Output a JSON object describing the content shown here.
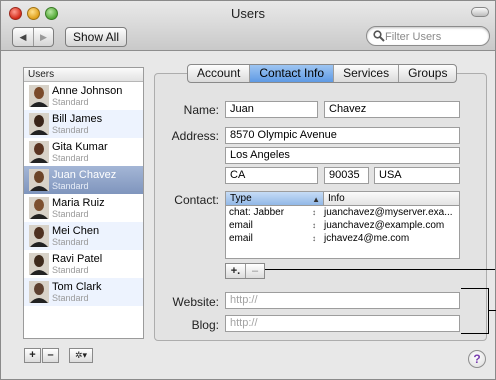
{
  "window": {
    "title": "Users"
  },
  "toolbar": {
    "back_label": "◀",
    "forward_label": "▶",
    "show_all_label": "Show All",
    "search_placeholder": "Filter Users"
  },
  "users": {
    "header": "Users",
    "items": [
      {
        "name": "Anne Johnson",
        "role": "Standard",
        "selected": false
      },
      {
        "name": "Bill James",
        "role": "Standard",
        "selected": false
      },
      {
        "name": "Gita Kumar",
        "role": "Standard",
        "selected": false
      },
      {
        "name": "Juan Chavez",
        "role": "Standard",
        "selected": true
      },
      {
        "name": "Maria Ruiz",
        "role": "Standard",
        "selected": false
      },
      {
        "name": "Mei Chen",
        "role": "Standard",
        "selected": false
      },
      {
        "name": "Ravi Patel",
        "role": "Standard",
        "selected": false
      },
      {
        "name": "Tom Clark",
        "role": "Standard",
        "selected": false
      }
    ]
  },
  "tabs": [
    {
      "label": "Account",
      "active": false
    },
    {
      "label": "Contact Info",
      "active": true
    },
    {
      "label": "Services",
      "active": false
    },
    {
      "label": "Groups",
      "active": false
    }
  ],
  "form": {
    "name_label": "Name:",
    "first_name": "Juan",
    "last_name": "Chavez",
    "address_label": "Address:",
    "street": "8570 Olympic Avenue",
    "city": "Los Angeles",
    "state": "CA",
    "zip": "90035",
    "country": "USA",
    "contact_label": "Contact:",
    "website_label": "Website:",
    "website_placeholder": "http://",
    "blog_label": "Blog:",
    "blog_placeholder": "http://"
  },
  "contact_table": {
    "col_type": "Type",
    "col_info": "Info",
    "sort_arrow": "▲",
    "stepper": "↕",
    "rows": [
      {
        "type": "chat: Jabber",
        "info": "juanchavez@myserver.exa..."
      },
      {
        "type": "email",
        "info": "juanchavez@example.com"
      },
      {
        "type": "email",
        "info": "jchavez4@me.com"
      }
    ],
    "add_label": "+.",
    "remove_label": "–"
  },
  "bottom": {
    "add_label": "+",
    "remove_label": "–",
    "action_label": "✲▾",
    "help_label": "?"
  },
  "colors": {
    "selection": "#7f95bd",
    "active_tab": "#5f9ae4",
    "help": "#7a3fb0"
  },
  "icons": [
    "close-icon",
    "minimize-icon",
    "zoom-icon",
    "toolbar-pill-icon",
    "search-icon",
    "avatar-icon",
    "gear-icon",
    "help-icon"
  ]
}
